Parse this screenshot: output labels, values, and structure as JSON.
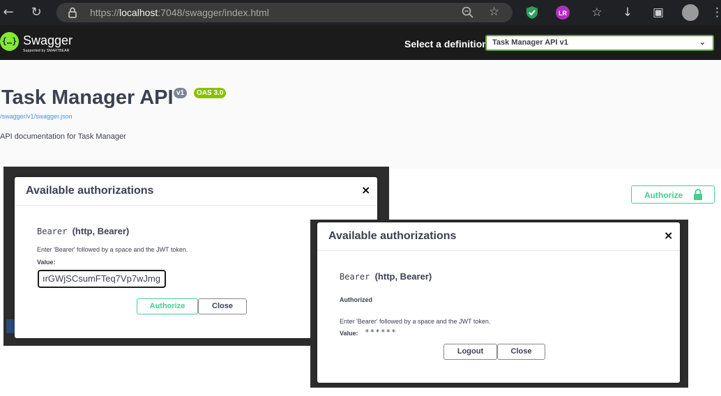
{
  "browser": {
    "back_icon": "back-arrow-icon",
    "reload_icon": "reload-icon",
    "url_prefix": "https://",
    "url_host": "localhost",
    "url_rest": ":7048/swagger/index.html",
    "extension_badge": "LR"
  },
  "topbar": {
    "logo_text": "Swagger",
    "logo_symbol": "{…}",
    "logo_sub": "Supported by SMARTBEAR",
    "select_label": "Select a definition",
    "select_value": "Task Manager API v1"
  },
  "info": {
    "title": "Task Manager API",
    "version_badge": "v1",
    "oas_badge": "OAS 3.0",
    "spec_link": "/swagger/v1/swagger.json",
    "description": "API documentation for Task Manager"
  },
  "authorize_button": {
    "label": "Authorize"
  },
  "modal_left": {
    "title": "Available authorizations",
    "close": "×",
    "scheme_name": "Bearer",
    "scheme_type": "(http, Bearer)",
    "instruction": "Enter 'Bearer' followed by a space and the JWT token.",
    "value_label": "Value:",
    "token_value": "ırGWjSCsumFTeq7Vp7wJmg",
    "authorize_label": "Authorize",
    "close_label": "Close"
  },
  "modal_right": {
    "title": "Available authorizations",
    "close": "×",
    "scheme_name": "Bearer",
    "scheme_type": "(http, Bearer)",
    "status": "Authorized",
    "instruction": "Enter 'Bearer' followed by a space and the JWT token.",
    "value_label": "Value:",
    "masked_value": "******",
    "logout_label": "Logout",
    "close_label": "Close"
  },
  "colors": {
    "accent_green": "#49cc90",
    "swagger_green": "#85ea2d",
    "topbar_bg": "#1b1b1b",
    "oas_badge": "#89bf04",
    "version_badge": "#7d8492",
    "link_blue": "#4990e2"
  }
}
